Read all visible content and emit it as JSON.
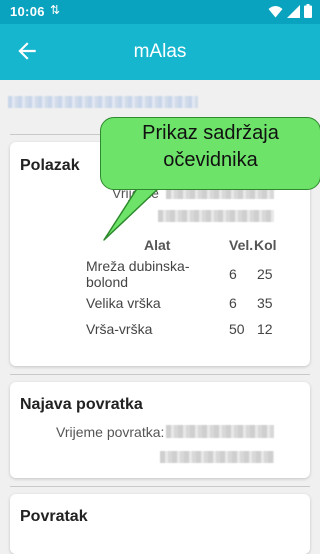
{
  "status": {
    "time": "10:06"
  },
  "app": {
    "title": "mAlas"
  },
  "tooltip": {
    "line1": "Prikaz sadržaja",
    "line2": "očevidnika"
  },
  "departure": {
    "title": "Polazak",
    "time_label": "Vrijeme",
    "table": {
      "headers": [
        "Alat",
        "Vel.",
        "Kol"
      ],
      "rows": [
        [
          "Mreža dubinska-bolond",
          "6",
          "25"
        ],
        [
          "Velika vrška",
          "6",
          "35"
        ],
        [
          "Vrša-vrška",
          "50",
          "12"
        ]
      ]
    }
  },
  "return_notice": {
    "title": "Najava povratka",
    "time_label": "Vrijeme povratka:"
  },
  "return": {
    "title": "Povratak"
  },
  "icons": [
    "arrow-back-icon",
    "wifi-icon",
    "signal-icon",
    "battery-icon",
    "sync-icon"
  ],
  "colors": {
    "app_bar": "#17b6cf",
    "status_bar": "#0aa3bf",
    "tooltip": "#6ee36a"
  }
}
